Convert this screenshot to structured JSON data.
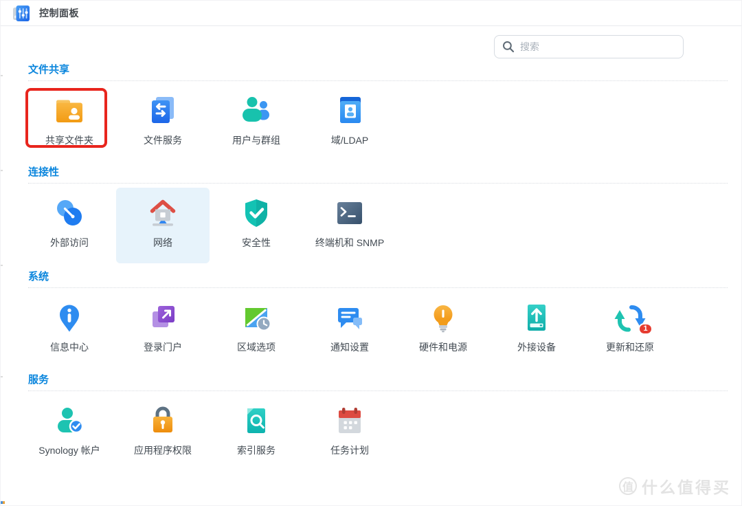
{
  "window": {
    "title": "控制面板",
    "app_icon": "control-panel-icon"
  },
  "search": {
    "placeholder": "搜索",
    "icon": "search-icon"
  },
  "sections": [
    {
      "title": "文件共享",
      "items": [
        {
          "label": "共享文件夹",
          "icon": "shared-folder-icon",
          "annotated": true
        },
        {
          "label": "文件服务",
          "icon": "file-services-icon"
        },
        {
          "label": "用户与群组",
          "icon": "users-groups-icon"
        },
        {
          "label": "域/LDAP",
          "icon": "domain-ldap-icon"
        }
      ]
    },
    {
      "title": "连接性",
      "items": [
        {
          "label": "外部访问",
          "icon": "external-access-icon"
        },
        {
          "label": "网络",
          "icon": "network-icon",
          "selected": true
        },
        {
          "label": "安全性",
          "icon": "security-icon"
        },
        {
          "label": "终端机和 SNMP",
          "icon": "terminal-snmp-icon"
        }
      ]
    },
    {
      "title": "系统",
      "items": [
        {
          "label": "信息中心",
          "icon": "info-center-icon"
        },
        {
          "label": "登录门户",
          "icon": "login-portal-icon"
        },
        {
          "label": "区域选项",
          "icon": "regional-options-icon"
        },
        {
          "label": "通知设置",
          "icon": "notification-settings-icon"
        },
        {
          "label": "硬件和电源",
          "icon": "hardware-power-icon"
        },
        {
          "label": "外接设备",
          "icon": "external-devices-icon"
        },
        {
          "label": "更新和还原",
          "icon": "update-restore-icon",
          "badge": "1"
        }
      ]
    },
    {
      "title": "服务",
      "items": [
        {
          "label": "Synology 帐户",
          "icon": "synology-account-icon"
        },
        {
          "label": "应用程序权限",
          "icon": "app-privileges-icon"
        },
        {
          "label": "索引服务",
          "icon": "indexing-service-icon"
        },
        {
          "label": "任务计划",
          "icon": "task-scheduler-icon"
        }
      ]
    }
  ],
  "watermark": {
    "badge": "值",
    "text": "什么值得买"
  },
  "colors": {
    "section_title": "#0b86dd",
    "annotation_red": "#e8251d",
    "selected_tile_bg": "#e7f3fb",
    "badge_red": "#e63c30",
    "label_text": "#424a52"
  }
}
